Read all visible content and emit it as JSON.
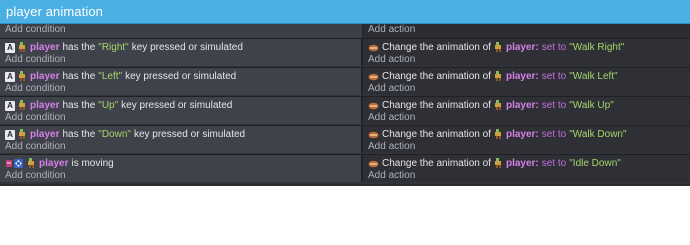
{
  "group": {
    "title": "player animation"
  },
  "top": {
    "add_condition": "Add condition",
    "add_action": "Add action"
  },
  "events": [
    {
      "condition": {
        "object": "player",
        "text1": "has the",
        "key": "\"Right\"",
        "text2": "key pressed or simulated",
        "icon": "keyboard-a-icon"
      },
      "action": {
        "text": "Change the animation of",
        "object": "player:",
        "set": "set to",
        "value": "\"Walk Right\"",
        "icon": "animation-icon"
      },
      "add_condition": "Add condition",
      "add_action": "Add action"
    },
    {
      "condition": {
        "object": "player",
        "text1": "has the",
        "key": "\"Left\"",
        "text2": "key pressed or simulated",
        "icon": "keyboard-a-icon"
      },
      "action": {
        "text": "Change the animation of",
        "object": "player:",
        "set": "set to",
        "value": "\"Walk Left\"",
        "icon": "animation-icon"
      },
      "add_condition": "Add condition",
      "add_action": "Add action"
    },
    {
      "condition": {
        "object": "player",
        "text1": "has the",
        "key": "\"Up\"",
        "text2": "key pressed or simulated",
        "icon": "keyboard-a-icon"
      },
      "action": {
        "text": "Change the animation of",
        "object": "player:",
        "set": "set to",
        "value": "\"Walk Up\"",
        "icon": "animation-icon"
      },
      "add_condition": "Add condition",
      "add_action": "Add action"
    },
    {
      "condition": {
        "object": "player",
        "text1": "has the",
        "key": "\"Down\"",
        "text2": "key pressed or simulated",
        "icon": "keyboard-a-icon"
      },
      "action": {
        "text": "Change the animation of",
        "object": "player:",
        "set": "set to",
        "value": "\"Walk Down\"",
        "icon": "animation-icon"
      },
      "add_condition": "Add condition",
      "add_action": "Add action"
    },
    {
      "condition": {
        "object": "player",
        "text1": "is moving",
        "icon": "movement-icon"
      },
      "action": {
        "text": "Change the animation of",
        "object": "player:",
        "set": "set to",
        "value": "\"Idle Down\"",
        "icon": "animation-icon"
      },
      "add_condition": "Add condition",
      "add_action": "Add action"
    }
  ],
  "colors": {
    "header": "#4ab0e4",
    "object": "#d580e8",
    "string": "#a5d46a",
    "keyword": "#c56ee0",
    "condition_bg": "#3f424a",
    "action_bg": "#2e3035"
  }
}
